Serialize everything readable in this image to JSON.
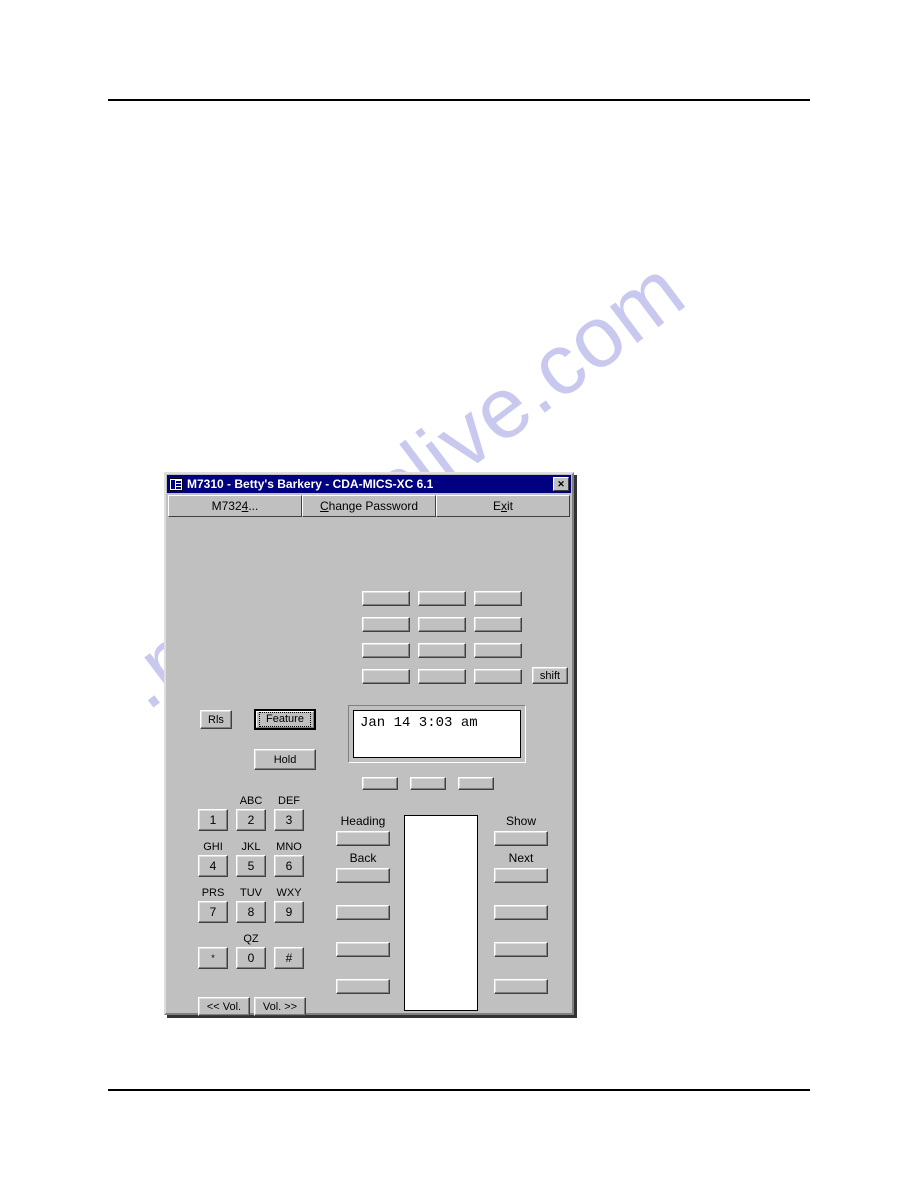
{
  "page": {
    "watermark_text": ".manualslive.com",
    "rule_color": "#000000",
    "background": "#ffffff"
  },
  "window": {
    "title": "M7310 - Betty's Barkery - CDA-MICS-XC 6.1",
    "title_icon": "application-icon",
    "close_label": "✕",
    "titlebar_color": "#000080",
    "face_color": "#c0c0c0",
    "menu": [
      {
        "label_prefix": "M732",
        "accel": "4",
        "label_suffix": "...",
        "name": "m7324"
      },
      {
        "label_prefix": "",
        "accel": "C",
        "label_suffix": "hange Password",
        "name": "change-password"
      },
      {
        "label_prefix": "E",
        "accel": "x",
        "label_suffix": "it",
        "name": "exit"
      }
    ]
  },
  "phone": {
    "memory_keys": [
      {
        "label": ""
      },
      {
        "label": ""
      },
      {
        "label": ""
      },
      {
        "label": ""
      },
      {
        "label": ""
      },
      {
        "label": ""
      },
      {
        "label": ""
      },
      {
        "label": ""
      },
      {
        "label": ""
      },
      {
        "label": ""
      },
      {
        "label": ""
      },
      {
        "label": ""
      }
    ],
    "shift_label": "shift",
    "rls_label": "Rls",
    "feature_label": "Feature",
    "hold_label": "Hold",
    "display": {
      "line1": "Jan 14 3:03 am",
      "line2": ""
    },
    "lcd_soft_keys": [
      {
        "label": ""
      },
      {
        "label": ""
      },
      {
        "label": ""
      }
    ],
    "dialpad": [
      {
        "digit": "1",
        "letters": ""
      },
      {
        "digit": "2",
        "letters": "ABC"
      },
      {
        "digit": "3",
        "letters": "DEF"
      },
      {
        "digit": "4",
        "letters": "GHI"
      },
      {
        "digit": "5",
        "letters": "JKL"
      },
      {
        "digit": "6",
        "letters": "MNO"
      },
      {
        "digit": "7",
        "letters": "PRS"
      },
      {
        "digit": "8",
        "letters": "TUV"
      },
      {
        "digit": "9",
        "letters": "WXY"
      },
      {
        "digit": "*",
        "letters": ""
      },
      {
        "digit": "0",
        "letters": "QZ"
      },
      {
        "digit": "#",
        "letters": ""
      }
    ],
    "volume": {
      "down_label": "<< Vol.",
      "up_label": "Vol. >>"
    },
    "left_soft_keys": [
      {
        "label": "Heading"
      },
      {
        "label": "Back"
      },
      {
        "label": ""
      },
      {
        "label": ""
      },
      {
        "label": ""
      }
    ],
    "right_soft_keys": [
      {
        "label": "Show"
      },
      {
        "label": "Next"
      },
      {
        "label": ""
      },
      {
        "label": ""
      },
      {
        "label": ""
      }
    ],
    "directory_text": ""
  }
}
